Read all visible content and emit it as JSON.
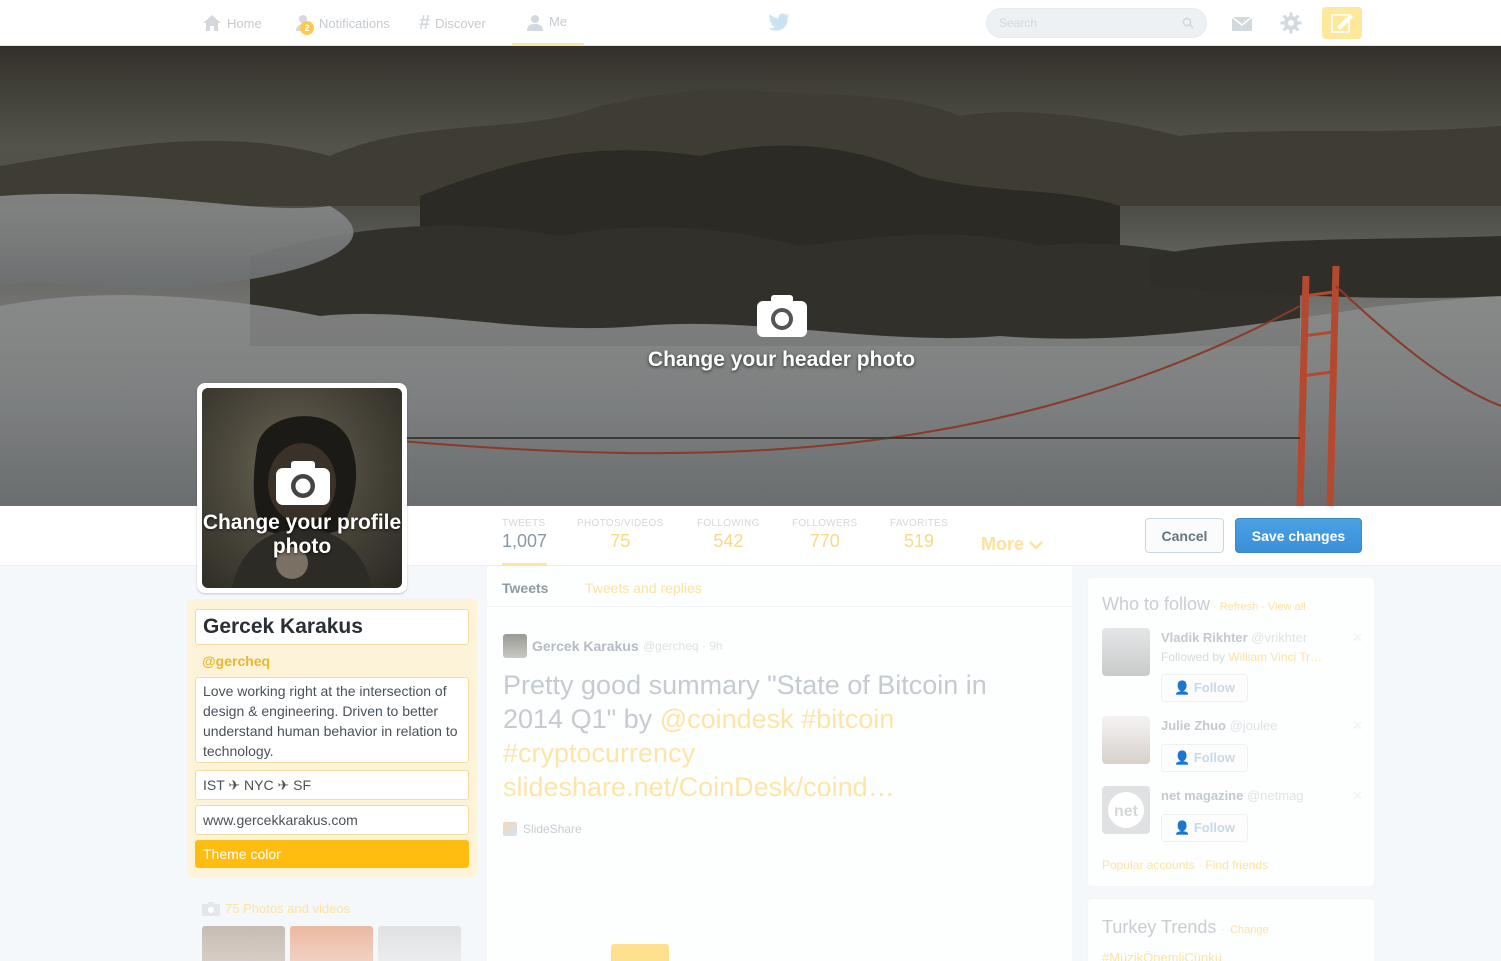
{
  "nav": {
    "home": "Home",
    "notifications": "Notifications",
    "notifications_count": "2",
    "discover": "Discover",
    "me": "Me",
    "search_placeholder": "Search"
  },
  "header": {
    "change_header_photo": "Change your header photo",
    "change_profile_photo": "Change your profile photo"
  },
  "stats": [
    {
      "label": "TWEETS",
      "value": "1,007"
    },
    {
      "label": "PHOTOS/VIDEOS",
      "value": "75"
    },
    {
      "label": "FOLLOWING",
      "value": "542"
    },
    {
      "label": "FOLLOWERS",
      "value": "770"
    },
    {
      "label": "FAVORITES",
      "value": "519"
    }
  ],
  "more_label": "More",
  "actions": {
    "cancel": "Cancel",
    "save": "Save changes"
  },
  "profile": {
    "name": "Gercek Karakus",
    "handle": "@gercheq",
    "bio": "Love working right at the intersection of design & engineering. Driven to better understand human behavior in relation to technology.",
    "location": "IST ✈ NYC ✈ SF",
    "website": "www.gercekkarakus.com",
    "theme_color_label": "Theme color",
    "theme_color": "#ffbd12",
    "photos_label": "75 Photos and videos"
  },
  "timeline": {
    "tabs": [
      "Tweets",
      "Tweets and replies"
    ],
    "tweet": {
      "author": "Gercek Karakus",
      "handle": "@gercheq",
      "time": "9h",
      "text_plain": "Pretty good summary \"State of Bitcoin in 2014 Q1\" by ",
      "mention": "@coindesk",
      "hashtag1": "#bitcoin",
      "hashtag2": "#cryptocurrency",
      "link": "slideshare.net/CoinDesk/coind…",
      "source": "SlideShare"
    }
  },
  "who_to_follow": {
    "title": "Who to follow",
    "refresh": "Refresh",
    "view_all": "View all",
    "people": [
      {
        "name": "Vladik Rikhter",
        "handle": "@vrikhter",
        "followed_by_prefix": "Followed by",
        "followed_by": "William Vinci Tr…",
        "follow_label": "Follow"
      },
      {
        "name": "Julie Zhuo",
        "handle": "@joulee",
        "follow_label": "Follow"
      },
      {
        "name": "net magazine",
        "handle": "@netmag",
        "follow_label": "Follow"
      }
    ],
    "popular": "Popular accounts",
    "find_friends": "Find friends"
  },
  "trends": {
    "title": "Turkey Trends",
    "change": "Change",
    "first": "#MüzikÖnemliÇünkü"
  },
  "colors": {
    "accent": "#ffbd12",
    "save_blue": "#3b8fd8"
  }
}
